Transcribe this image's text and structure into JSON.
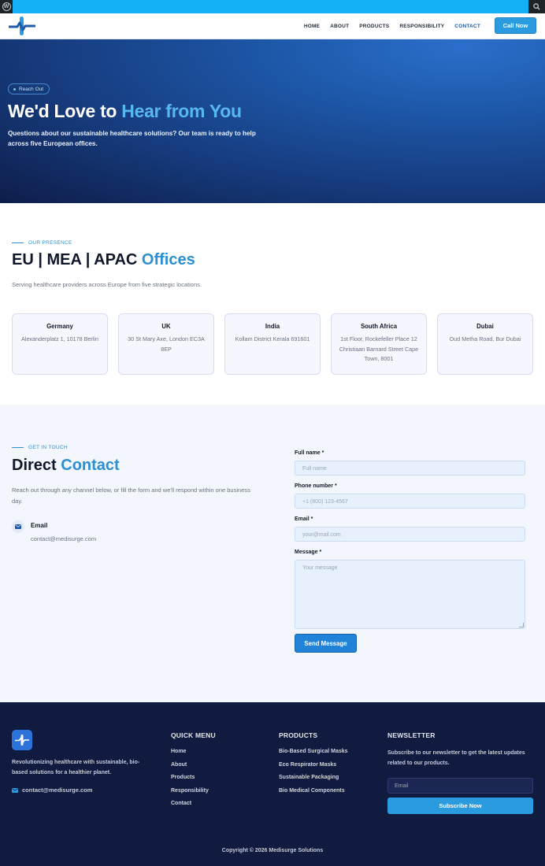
{
  "header": {
    "nav": [
      "HOME",
      "ABOUT",
      "PRODUCTS",
      "RESPONSIBILITY",
      "CONTACT"
    ],
    "active_nav": "CONTACT",
    "cta": "Call Now"
  },
  "hero": {
    "badge": "Reach Out",
    "title_main": "We'd Love to ",
    "title_accent": "Hear from You",
    "subtitle": "Questions about our sustainable healthcare solutions? Our team is ready to help across five European offices."
  },
  "presence": {
    "eyebrow": "OUR PRESENCE",
    "title_main": "EU | MEA | APAC ",
    "title_accent": "Offices",
    "subtitle": "Serving healthcare providers across Europe from five strategic locations.",
    "offices": [
      {
        "name": "Germany",
        "address": "Alexanderplatz 1, 10178 Berlin"
      },
      {
        "name": "UK",
        "address": "30 St Mary Axe, London EC3A 8EP"
      },
      {
        "name": "India",
        "address": "Kollam District Kerala 691601"
      },
      {
        "name": "South Africa",
        "address": "1st Floor, Rockefeller Place 12 Christiaan Barnard Street Cape Town, 8001"
      },
      {
        "name": "Dubai",
        "address": "Oud Metha Road, Bur Dubai"
      }
    ]
  },
  "contact": {
    "eyebrow": "GET IN TOUCH",
    "title_main": "Direct ",
    "title_accent": "Contact",
    "subtitle": "Reach out through any channel below, or fill the form and we'll respond within one business day.",
    "email_label": "Email",
    "email_value": "contact@medisurge.com",
    "form": {
      "fullname_label": "Full name *",
      "fullname_placeholder": "Full name",
      "phone_label": "Phone number *",
      "phone_placeholder": "+1 (800) 123-4567",
      "email_label": "Email *",
      "email_placeholder": "your@mail.com",
      "message_label": "Message *",
      "message_placeholder": "Your message",
      "submit": "Send Message"
    }
  },
  "footer": {
    "description": "Revolutionizing healthcare with sustainable, bio-based solutions for a healthier planet.",
    "email": "contact@medisurge.com",
    "quick_menu_title": "QUICK MENU",
    "quick_menu": [
      "Home",
      "About",
      "Products",
      "Responsibility",
      "Contact"
    ],
    "products_title": "PRODUCTS",
    "products": [
      "Bio-Based Surgical Masks",
      "Eco Respirator Masks",
      "Sustainable Packaging",
      "Bio Medical Components"
    ],
    "newsletter_title": "NEWSLETTER",
    "newsletter_text": "Subscribe to our newsletter to get the latest updates related to our products.",
    "newsletter_placeholder": "Email",
    "subscribe": "Subscribe Now",
    "copyright": "Copyright © 2026 Medisurge Solutions"
  },
  "colors": {
    "accent": "#2b8fd0",
    "admin_bar": "#14b0f5",
    "footer_bg": "#111b40",
    "hero_dark": "#0e1d4a"
  },
  "icons": [
    "wordpress-icon",
    "search-icon",
    "medisurge-logo",
    "email-icon"
  ]
}
